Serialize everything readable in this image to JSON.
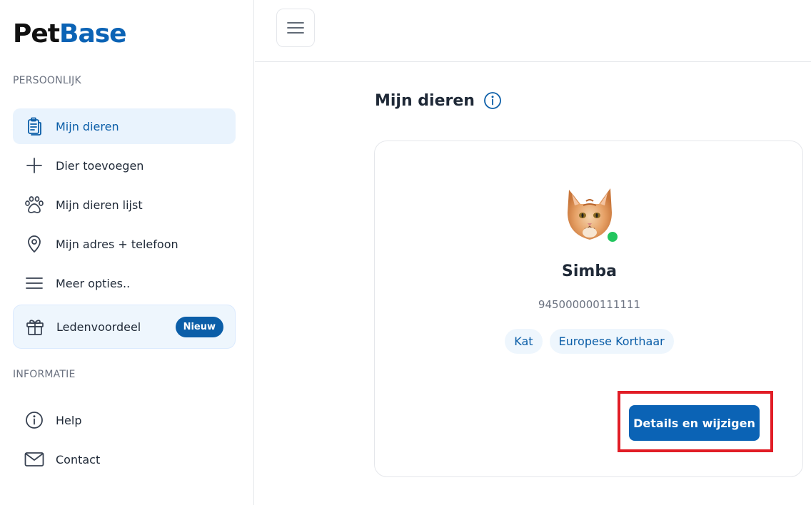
{
  "brand": {
    "part1": "Pet",
    "part2": "Base",
    "accent": "#0b63b5"
  },
  "sidebar": {
    "section_personal": "PERSOONLIJK",
    "section_info": "INFORMATIE",
    "items": [
      {
        "label": "Mijn dieren",
        "icon": "clipboard-icon",
        "active": true
      },
      {
        "label": "Dier toevoegen",
        "icon": "plus-icon"
      },
      {
        "label": "Mijn dieren lijst",
        "icon": "paw-icon"
      },
      {
        "label": "Mijn adres + telefoon",
        "icon": "location-pin-icon"
      },
      {
        "label": "Meer opties..",
        "icon": "menu-lines-icon"
      }
    ],
    "promo": {
      "label": "Ledenvoordeel",
      "badge": "Nieuw",
      "icon": "gift-icon"
    },
    "info_items": [
      {
        "label": "Help",
        "icon": "info-circle-icon"
      },
      {
        "label": "Contact",
        "icon": "mail-icon"
      }
    ]
  },
  "topbar": {
    "menu_icon": "hamburger-icon"
  },
  "main": {
    "title": "Mijn dieren",
    "pet": {
      "name": "Simba",
      "chip_number": "945000000111111",
      "status_color": "#22c55e",
      "tags": [
        "Kat",
        "Europese Korthaar"
      ],
      "button": "Details en wijzigen"
    }
  }
}
